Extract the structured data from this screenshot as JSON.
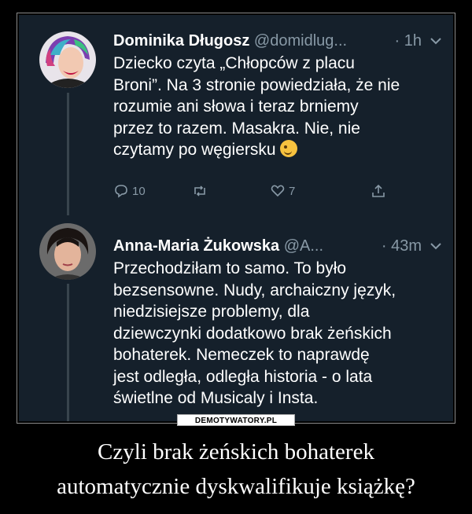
{
  "tweet1": {
    "name": "Dominika Długosz",
    "handle": "@domidlug...",
    "time": "· 1h",
    "text_lines": [
      "Dziecko czyta „Chłopców z placu",
      "Broni”. Na 3 stronie powiedziała, że nie",
      "rozumie ani słowa i teraz brniemy",
      "przez to razem. Masakra. Nie, nie",
      "czytamy po węgiersku"
    ],
    "emoji": "winking-face-emoji",
    "reply_count": "10",
    "retweet_count": "",
    "like_count": "7"
  },
  "tweet2": {
    "name": "Anna-Maria Żukowska",
    "handle": "@A...",
    "time": "· 43m",
    "text_lines": [
      "Przechodziłam to samo. To było",
      "bezsensowne. Nudy, archaiczny język,",
      "niedzisiejsze problemy, dla",
      "dziewczynki dodatkowo brak żeńskich",
      "bohaterek. Nemeczek to naprawdę",
      "jest odległa, odległa historia - o lata",
      "świetlne od Musicaly i Insta."
    ]
  },
  "watermark": "DEMOTYWATORY.PL",
  "caption_lines": [
    "Czyli brak żeńskich bohaterek",
    "automatycznie dyskwalifikuje książkę?"
  ],
  "colors": {
    "background": "#15202b",
    "text": "#ffffff",
    "muted": "#8899a6",
    "thread_line": "#38444d"
  }
}
